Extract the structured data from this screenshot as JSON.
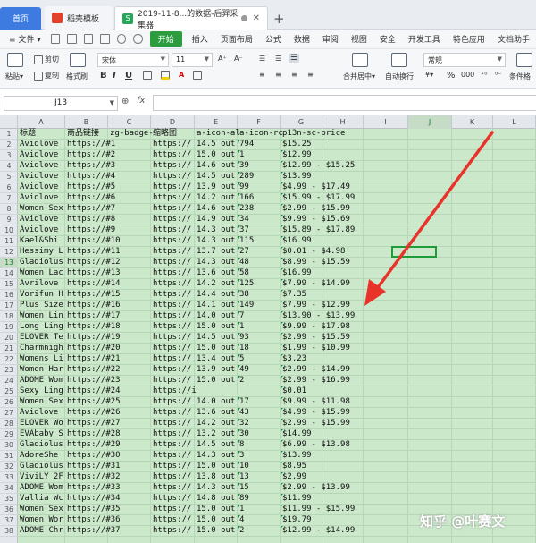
{
  "tabs": {
    "home": "首页",
    "template": "稻壳模板",
    "doc_icon": "S",
    "document": "2019-11-8...的数据-后羿采集器",
    "close": "✕",
    "add": "+"
  },
  "menu": {
    "file": "≡ 文件 ▾",
    "items": [
      "开始",
      "插入",
      "页面布局",
      "公式",
      "数据",
      "审阅",
      "视图",
      "安全",
      "开发工具",
      "特色应用",
      "文档助手"
    ]
  },
  "ribbon": {
    "paste": "粘贴▾",
    "cut": "剪切",
    "copy": "复制",
    "format_painter": "格式刷",
    "font_name": "宋体",
    "font_size": "11",
    "bold": "B",
    "italic": "I",
    "underline": "U",
    "merge": "合并居中▾",
    "wrap": "自动换行",
    "number_format": "常规",
    "percent": "%",
    "conditional": "条件格"
  },
  "formula_bar": {
    "cell_ref": "J13",
    "zoom_icon": "⊕",
    "fx": "fx",
    "value": ""
  },
  "grid": {
    "columns": [
      "A",
      "B",
      "C",
      "D",
      "E",
      "F",
      "G",
      "H",
      "I",
      "J",
      "K",
      "L"
    ],
    "selected_column": "J",
    "selected_row": "13",
    "rows": [
      {
        "n": "1",
        "a": "标题",
        "b": "商品链接",
        "c": "zg-badge-",
        "d": "缩略图",
        "e": "a-icon-al",
        "f": "a-icon-rc",
        "g": "p13n-sc-price"
      },
      {
        "n": "2",
        "a": "Avidlove",
        "b": "https://#1",
        "d": "https://",
        "e": "14.5 out",
        "f": "794",
        "g": "$15.25"
      },
      {
        "n": "3",
        "a": "Avidlove",
        "b": "https://#2",
        "d": "https://",
        "e": "15.0 out",
        "f": "1",
        "g": "$12.99"
      },
      {
        "n": "4",
        "a": "Avidlove",
        "b": "https://#3",
        "d": "https://",
        "e": "14.6 out",
        "f": "39",
        "g": "$12.99 - $15.25"
      },
      {
        "n": "5",
        "a": "Avidlove",
        "b": "https://#4",
        "d": "https://",
        "e": "14.5 out",
        "f": "289",
        "g": "$13.99"
      },
      {
        "n": "6",
        "a": "Avidlove",
        "b": "https://#5",
        "d": "https://",
        "e": "13.9 out",
        "f": "99",
        "g": "$4.99 - $17.49"
      },
      {
        "n": "7",
        "a": "Avidlove",
        "b": "https://#6",
        "d": "https://",
        "e": "14.2 out",
        "f": "166",
        "g": "$15.99 - $17.99"
      },
      {
        "n": "8",
        "a": "Women Sex",
        "b": "https://#7",
        "d": "https://",
        "e": "14.6 out",
        "f": "238",
        "g": "$2.99 - $15.99"
      },
      {
        "n": "9",
        "a": "Avidlove",
        "b": "https://#8",
        "d": "https://",
        "e": "14.9 out",
        "f": "34",
        "g": "$9.99 - $15.69"
      },
      {
        "n": "10",
        "a": "Avidlove",
        "b": "https://#9",
        "d": "https://",
        "e": "14.3 out",
        "f": "37",
        "g": "$15.89 - $17.89"
      },
      {
        "n": "11",
        "a": "Kael&Shi",
        "b": "https://#10",
        "d": "https://",
        "e": "14.3 out",
        "f": "115",
        "g": "$16.99"
      },
      {
        "n": "12",
        "a": "Hessimy L",
        "b": "https://#11",
        "d": "https://",
        "e": "13.7 out",
        "f": "27",
        "g": "$0.01 - $4.98"
      },
      {
        "n": "13",
        "a": "Gladiolus",
        "b": "https://#12",
        "d": "https://",
        "e": "14.3 out",
        "f": "48",
        "g": "$8.99 - $15.59"
      },
      {
        "n": "14",
        "a": "Women Lac",
        "b": "https://#13",
        "d": "https://",
        "e": "13.6 out",
        "f": "58",
        "g": "$16.99"
      },
      {
        "n": "15",
        "a": "Avrilove",
        "b": "https://#14",
        "d": "https://",
        "e": "14.2 out",
        "f": "125",
        "g": "$7.99 - $14.99"
      },
      {
        "n": "16",
        "a": "Vorifun H",
        "b": "https://#15",
        "d": "https://",
        "e": "14.4 out",
        "f": "38",
        "g": "$7.35"
      },
      {
        "n": "17",
        "a": "Plus Size",
        "b": "https://#16",
        "d": "https://",
        "e": "14.1 out",
        "f": "149",
        "g": "$7.99 - $12.99"
      },
      {
        "n": "18",
        "a": "Women Lin",
        "b": "https://#17",
        "d": "https://",
        "e": "14.0 out",
        "f": "7",
        "g": "$13.90 - $13.99"
      },
      {
        "n": "19",
        "a": "Long Ling",
        "b": "https://#18",
        "d": "https://",
        "e": "15.0 out",
        "f": "1",
        "g": "$9.99 - $17.98"
      },
      {
        "n": "20",
        "a": "ELOVER Te",
        "b": "https://#19",
        "d": "https://",
        "e": "14.5 out",
        "f": "93",
        "g": "$2.99 - $15.59"
      },
      {
        "n": "21",
        "a": "Charmnigh",
        "b": "https://#20",
        "d": "https://",
        "e": "15.0 out",
        "f": "18",
        "g": "$1.99 - $10.99"
      },
      {
        "n": "22",
        "a": "Womens Li",
        "b": "https://#21",
        "d": "https://",
        "e": "13.4 out",
        "f": "5",
        "g": "$3.23"
      },
      {
        "n": "23",
        "a": "Women Har",
        "b": "https://#22",
        "d": "https://",
        "e": "13.9 out",
        "f": "49",
        "g": "$2.99 - $14.99"
      },
      {
        "n": "24",
        "a": "ADOME Wom",
        "b": "https://#23",
        "d": "https://",
        "e": "15.0 out",
        "f": "2",
        "g": "$2.99 - $16.99"
      },
      {
        "n": "25",
        "a": "Sexy Ling",
        "b": "https://#24",
        "d": "https://i",
        "e": "",
        "f": "",
        "g": "$0.01"
      },
      {
        "n": "26",
        "a": "Women Sex",
        "b": "https://#25",
        "d": "https://",
        "e": "14.0 out",
        "f": "17",
        "g": "$9.99 - $11.98"
      },
      {
        "n": "27",
        "a": "Avidlove",
        "b": "https://#26",
        "d": "https://",
        "e": "13.6 out",
        "f": "43",
        "g": "$4.99 - $15.99"
      },
      {
        "n": "28",
        "a": "ELOVER Wo",
        "b": "https://#27",
        "d": "https://",
        "e": "14.2 out",
        "f": "32",
        "g": "$2.99 - $15.99"
      },
      {
        "n": "29",
        "a": "EVAbaby S",
        "b": "https://#28",
        "d": "https://",
        "e": "13.2 out",
        "f": "30",
        "g": "$14.99"
      },
      {
        "n": "30",
        "a": "Gladiolus",
        "b": "https://#29",
        "d": "https://",
        "e": "14.5 out",
        "f": "8",
        "g": "$6.99 - $13.98"
      },
      {
        "n": "31",
        "a": "AdoreShe",
        "b": "https://#30",
        "d": "https://",
        "e": "14.3 out",
        "f": "3",
        "g": "$13.99"
      },
      {
        "n": "32",
        "a": "Gladiolus",
        "b": "https://#31",
        "d": "https://",
        "e": "15.0 out",
        "f": "10",
        "g": "$8.95"
      },
      {
        "n": "33",
        "a": "ViviLY 2F",
        "b": "https://#32",
        "d": "https://",
        "e": "13.8 out",
        "f": "13",
        "g": "$2.99"
      },
      {
        "n": "34",
        "a": "ADOME Wom",
        "b": "https://#33",
        "d": "https://",
        "e": "14.3 out",
        "f": "15",
        "g": "$2.99 - $13.99"
      },
      {
        "n": "35",
        "a": "Vallia Wc",
        "b": "https://#34",
        "d": "https://",
        "e": "14.8 out",
        "f": "89",
        "g": "$11.99"
      },
      {
        "n": "36",
        "a": "Women Sex",
        "b": "https://#35",
        "d": "https://",
        "e": "15.0 out",
        "f": "1",
        "g": "$11.99 - $15.99"
      },
      {
        "n": "37",
        "a": "Women Wor",
        "b": "https://#36",
        "d": "https://",
        "e": "15.0 out",
        "f": "4",
        "g": "$19.79"
      },
      {
        "n": "38",
        "a": "ADOME Chr",
        "b": "https://#37",
        "d": "https://",
        "e": "15.0 out",
        "f": "2",
        "g": "$12.99 - $14.99"
      }
    ]
  },
  "watermark": "知乎 @叶赛文",
  "colors": {
    "accent_green": "#2c9c3f",
    "grid_background": "#cbe8cb",
    "arrow_red": "#e8332a",
    "home_tab": "#3e7be0"
  }
}
